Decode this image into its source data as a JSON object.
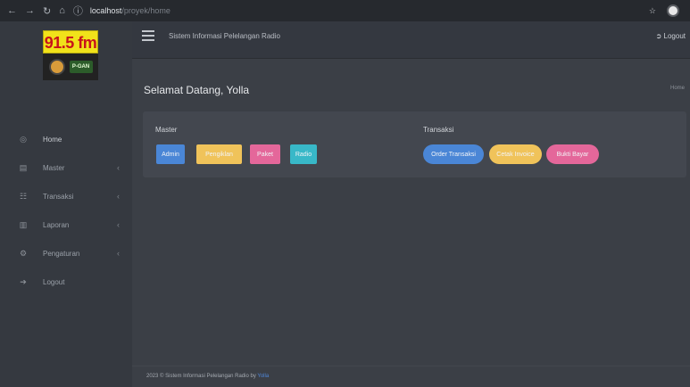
{
  "browser": {
    "nav_icons": [
      "arrow-left-icon",
      "arrow-right-icon",
      "reload-icon",
      "home-icon",
      "info-icon"
    ],
    "url_host": "localhost",
    "url_path": "/proyek/home",
    "right_icons": [
      "star-icon",
      "profile-icon"
    ]
  },
  "logo": {
    "frequency": "91.5 fm",
    "badge": "P-GAN"
  },
  "sidebar": {
    "items": [
      {
        "label": "Home",
        "icon": "home-icon",
        "has_children": false
      },
      {
        "label": "Master",
        "icon": "folder-icon",
        "has_children": true
      },
      {
        "label": "Transaksi",
        "icon": "cart-icon",
        "has_children": true
      },
      {
        "label": "Laporan",
        "icon": "report-icon",
        "has_children": true
      },
      {
        "label": "Pengaturan",
        "icon": "gear-icon",
        "has_children": true
      },
      {
        "label": "Logout",
        "icon": "logout-icon",
        "has_children": false
      }
    ]
  },
  "topbar": {
    "app_title": "Sistem Informasi Pelelangan Radio",
    "logout_label": "Logout"
  },
  "page": {
    "title": "Selamat Datang, Yolla",
    "breadcrumb": "Home"
  },
  "card": {
    "master_label": "Master",
    "transaksi_label": "Transaksi",
    "master_buttons": [
      {
        "label": "Admin",
        "color": "#4a86d6"
      },
      {
        "label": "Pengiklan",
        "color": "#f0c35a"
      },
      {
        "label": "Paket",
        "color": "#e4679a"
      },
      {
        "label": "Radio",
        "color": "#38b8c8"
      }
    ],
    "transaksi_buttons": [
      {
        "label": "Order Transaksi",
        "color": "#4a86d6"
      },
      {
        "label": "Cetak Invoice",
        "color": "#f0c35a"
      },
      {
        "label": "Bukti Bayar",
        "color": "#e4679a"
      }
    ]
  },
  "footer": {
    "text": "2023 © Sistem Informasi Pelelangan Radio by",
    "link": "Yolla"
  }
}
